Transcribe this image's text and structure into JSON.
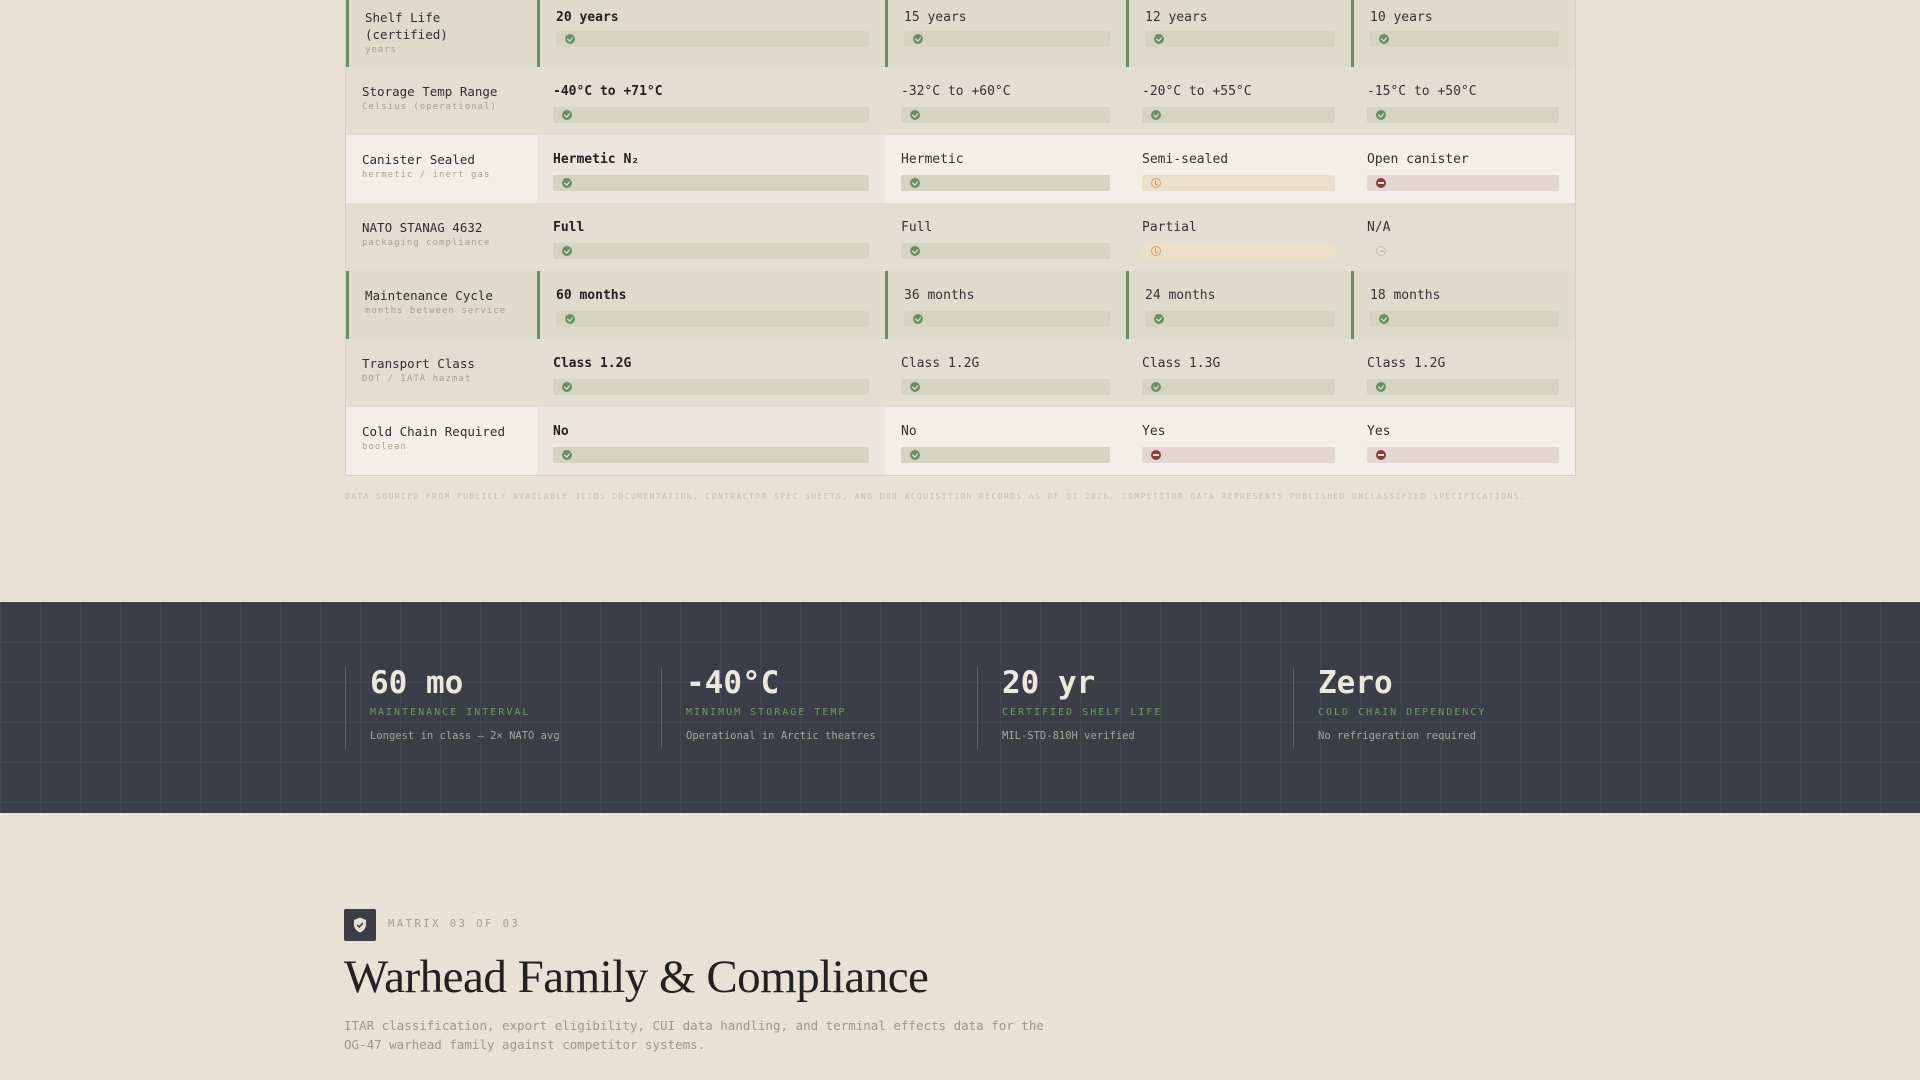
{
  "matrix": {
    "rows": [
      {
        "label": "Shelf Life\n(certified)",
        "sub": "years",
        "style": "hl first",
        "cells": [
          {
            "v": "20 years",
            "s": "good"
          },
          {
            "v": "15 years",
            "s": "good"
          },
          {
            "v": "12 years",
            "s": "good"
          },
          {
            "v": "10 years",
            "s": "good"
          }
        ]
      },
      {
        "label": "Storage Temp Range",
        "sub": "Celsius (operational)",
        "style": "",
        "cells": [
          {
            "v": "-40°C to +71°C",
            "s": "good"
          },
          {
            "v": "-32°C to +60°C",
            "s": "good"
          },
          {
            "v": "-20°C to +55°C",
            "s": "good"
          },
          {
            "v": "-15°C to +50°C",
            "s": "good"
          }
        ]
      },
      {
        "label": "Canister Sealed",
        "sub": "hermetic / inert gas",
        "style": "alt",
        "cells": [
          {
            "v": "Hermetic N₂",
            "s": "good"
          },
          {
            "v": "Hermetic",
            "s": "good"
          },
          {
            "v": "Semi-sealed",
            "s": "warn"
          },
          {
            "v": "Open canister",
            "s": "bad"
          }
        ]
      },
      {
        "label": "NATO STANAG 4632",
        "sub": "packaging compliance",
        "style": "",
        "cells": [
          {
            "v": "Full",
            "s": "good"
          },
          {
            "v": "Full",
            "s": "good"
          },
          {
            "v": "Partial",
            "s": "warn"
          },
          {
            "v": "N/A",
            "s": "none"
          }
        ]
      },
      {
        "label": "Maintenance Cycle",
        "sub": "months between service",
        "style": "hl",
        "cells": [
          {
            "v": "60 months",
            "s": "good"
          },
          {
            "v": "36 months",
            "s": "good"
          },
          {
            "v": "24 months",
            "s": "good"
          },
          {
            "v": "18 months",
            "s": "good"
          }
        ]
      },
      {
        "label": "Transport Class",
        "sub": "DOT / IATA hazmat",
        "style": "",
        "cells": [
          {
            "v": "Class 1.2G",
            "s": "good"
          },
          {
            "v": "Class 1.2G",
            "s": "good"
          },
          {
            "v": "Class 1.3G",
            "s": "good"
          },
          {
            "v": "Class 1.2G",
            "s": "good"
          }
        ]
      },
      {
        "label": "Cold Chain Required",
        "sub": "boolean",
        "style": "alt",
        "cells": [
          {
            "v": "No",
            "s": "good"
          },
          {
            "v": "No",
            "s": "good"
          },
          {
            "v": "Yes",
            "s": "bad"
          },
          {
            "v": "Yes",
            "s": "bad"
          }
        ]
      }
    ],
    "footnote": "Data sourced from publicly available JCIDS documentation, contractor spec sheets, and DoD acquisition records as of Q1 2026. Competitor data represents published unclassified specifications."
  },
  "stats": [
    {
      "value": "60 mo",
      "caption": "MAINTENANCE INTERVAL",
      "note": "Longest in class — 2× NATO avg"
    },
    {
      "value": "-40°C",
      "caption": "MINIMUM STORAGE TEMP",
      "note": "Operational in Arctic theatres"
    },
    {
      "value": "20 yr",
      "caption": "CERTIFIED SHELF LIFE",
      "note": "MIL-STD-810H verified"
    },
    {
      "value": "Zero",
      "caption": "COLD CHAIN DEPENDENCY",
      "note": "No refrigeration required"
    }
  ],
  "section": {
    "icon": "shield-check-icon",
    "kicker": "MATRIX 03 OF 03",
    "title": "Warhead Family & Compliance",
    "description": "ITAR classification, export eligibility, CUI data handling, and terminal effects data for the OG-47 warhead family against competitor systems."
  },
  "colors": {
    "accent": "#6b8c64",
    "band": "#3b3e46",
    "bg": "#e7e1d6",
    "warn": "#d8a05a",
    "bad": "#8a3c3c"
  }
}
